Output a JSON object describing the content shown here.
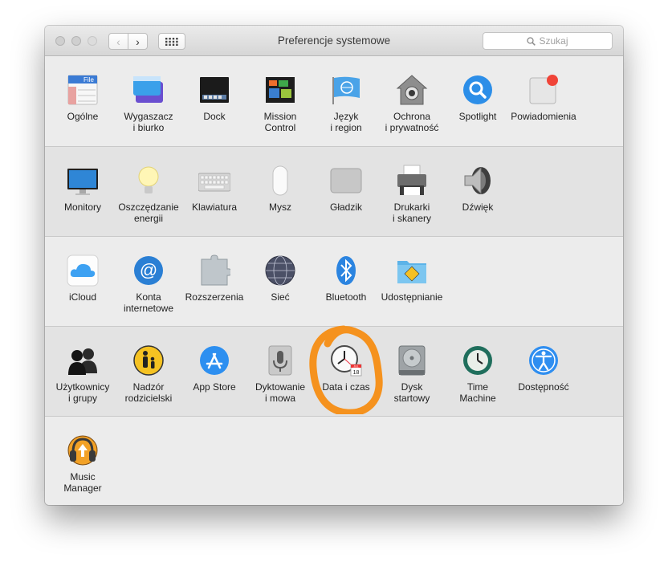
{
  "window": {
    "title": "Preferencje systemowe",
    "search_placeholder": "Szukaj"
  },
  "sections": [
    {
      "items": [
        {
          "label": "Ogólne",
          "icon": "general-icon",
          "badge_text": "File"
        },
        {
          "label": "Wygaszacz\ni biurko",
          "icon": "desktop-screensaver-icon"
        },
        {
          "label": "Dock",
          "icon": "dock-icon"
        },
        {
          "label": "Mission\nControl",
          "icon": "mission-control-icon"
        },
        {
          "label": "Język\ni region",
          "icon": "language-region-icon"
        },
        {
          "label": "Ochrona\ni prywatność",
          "icon": "security-privacy-icon"
        },
        {
          "label": "Spotlight",
          "icon": "spotlight-icon"
        },
        {
          "label": "Powiadomienia",
          "icon": "notifications-icon"
        }
      ]
    },
    {
      "items": [
        {
          "label": "Monitory",
          "icon": "displays-icon"
        },
        {
          "label": "Oszczędzanie\nenergii",
          "icon": "energy-saver-icon"
        },
        {
          "label": "Klawiatura",
          "icon": "keyboard-icon"
        },
        {
          "label": "Mysz",
          "icon": "mouse-icon"
        },
        {
          "label": "Gładzik",
          "icon": "trackpad-icon"
        },
        {
          "label": "Drukarki\ni skanery",
          "icon": "printers-scanners-icon"
        },
        {
          "label": "Dźwięk",
          "icon": "sound-icon"
        }
      ]
    },
    {
      "items": [
        {
          "label": "iCloud",
          "icon": "icloud-icon"
        },
        {
          "label": "Konta\ninternetowe",
          "icon": "internet-accounts-icon"
        },
        {
          "label": "Rozszerzenia",
          "icon": "extensions-icon"
        },
        {
          "label": "Sieć",
          "icon": "network-icon"
        },
        {
          "label": "Bluetooth",
          "icon": "bluetooth-icon"
        },
        {
          "label": "Udostępnianie",
          "icon": "sharing-icon"
        }
      ]
    },
    {
      "items": [
        {
          "label": "Użytkownicy\ni grupy",
          "icon": "users-groups-icon"
        },
        {
          "label": "Nadzór\nrodzicielski",
          "icon": "parental-controls-icon"
        },
        {
          "label": "App Store",
          "icon": "app-store-icon"
        },
        {
          "label": "Dyktowanie\ni mowa",
          "icon": "dictation-speech-icon"
        },
        {
          "label": "Data i czas",
          "icon": "date-time-icon",
          "calendar_month": "JUL",
          "calendar_day": "18"
        },
        {
          "label": "Dysk\nstartowy",
          "icon": "startup-disk-icon"
        },
        {
          "label": "Time\nMachine",
          "icon": "time-machine-icon"
        },
        {
          "label": "Dostępność",
          "icon": "accessibility-icon"
        }
      ]
    },
    {
      "items": [
        {
          "label": "Music\nManager",
          "icon": "music-manager-icon"
        }
      ]
    }
  ],
  "annotation": {
    "color": "#f5921e",
    "target": "Data i czas"
  }
}
